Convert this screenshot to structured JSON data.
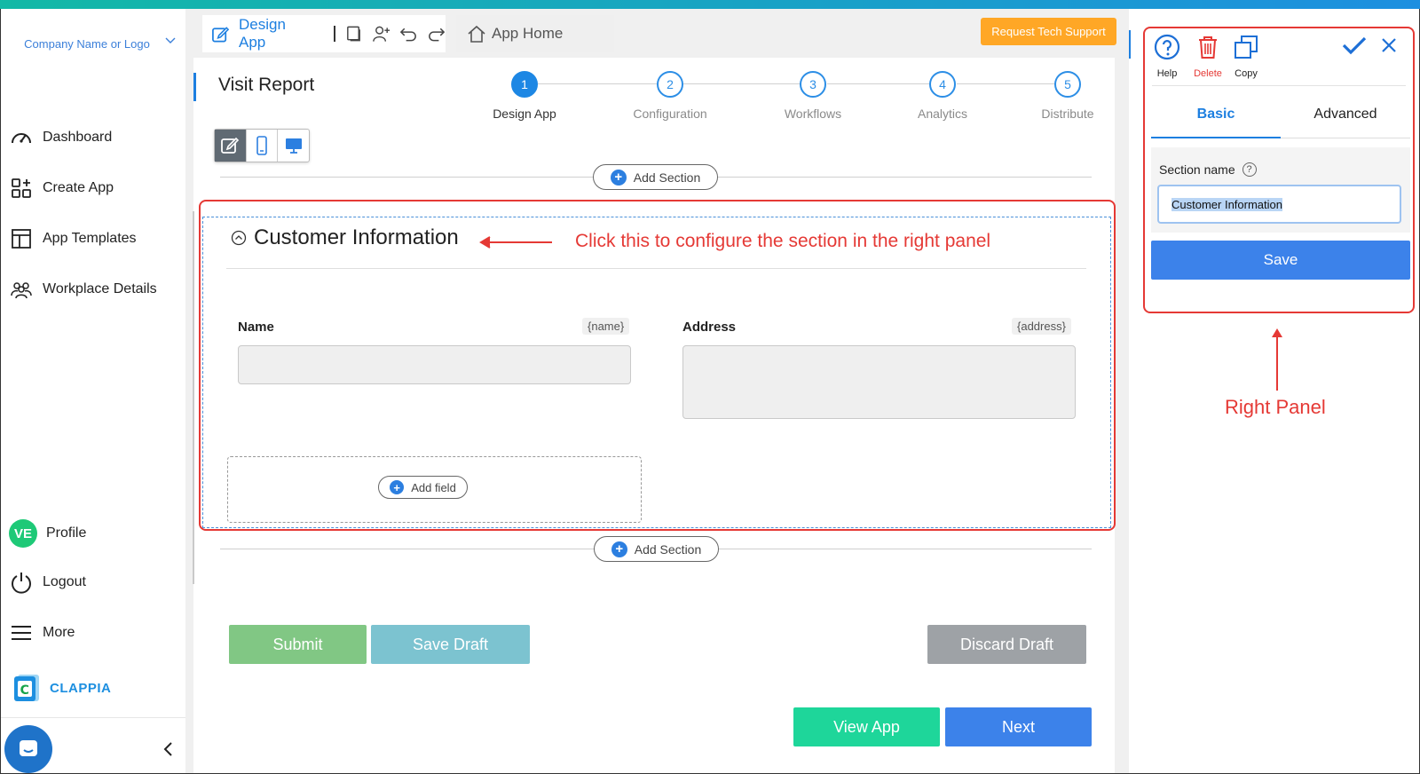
{
  "sidebar": {
    "company": "Company Name or Logo",
    "items": [
      {
        "label": "Dashboard",
        "icon": "gauge-icon"
      },
      {
        "label": "Create App",
        "icon": "grid-plus-icon"
      },
      {
        "label": "App Templates",
        "icon": "template-icon"
      },
      {
        "label": "Workplace Details",
        "icon": "users-icon"
      }
    ],
    "profile": {
      "initials": "VE",
      "label": "Profile"
    },
    "logout": "Logout",
    "more": "More",
    "brand": "CLAPPIA"
  },
  "toolbar": {
    "design_tab": "Design App",
    "home_tab": "App Home",
    "support": "Request Tech Support"
  },
  "page": {
    "title": "Visit Report"
  },
  "steps": [
    {
      "num": "1",
      "label": "Design App",
      "active": true
    },
    {
      "num": "2",
      "label": "Configuration",
      "active": false
    },
    {
      "num": "3",
      "label": "Workflows",
      "active": false
    },
    {
      "num": "4",
      "label": "Analytics",
      "active": false
    },
    {
      "num": "5",
      "label": "Distribute",
      "active": false
    }
  ],
  "canvas": {
    "add_section": "Add Section",
    "section_title": "Customer Information",
    "annotation": "Click this to configure the section in the right panel",
    "fields": [
      {
        "label": "Name",
        "tag": "{name}"
      },
      {
        "label": "Address",
        "tag": "{address}"
      }
    ],
    "add_field": "Add field"
  },
  "form_buttons": {
    "submit": "Submit",
    "save_draft": "Save Draft",
    "discard_draft": "Discard Draft",
    "view_app": "View App",
    "next": "Next"
  },
  "right_panel": {
    "help": "Help",
    "delete": "Delete",
    "copy": "Copy",
    "tab_basic": "Basic",
    "tab_advanced": "Advanced",
    "section_name_label": "Section name",
    "section_name_value": "Customer Information",
    "save": "Save",
    "caption": "Right Panel"
  },
  "colors": {
    "accent": "#1d7fe0",
    "annotation": "#e53935",
    "submit": "#81c784",
    "save_draft": "#7cc3d0",
    "discard": "#9ea2a6",
    "view_app": "#1ed69a",
    "next": "#3c82ea",
    "support": "#ffa726"
  }
}
